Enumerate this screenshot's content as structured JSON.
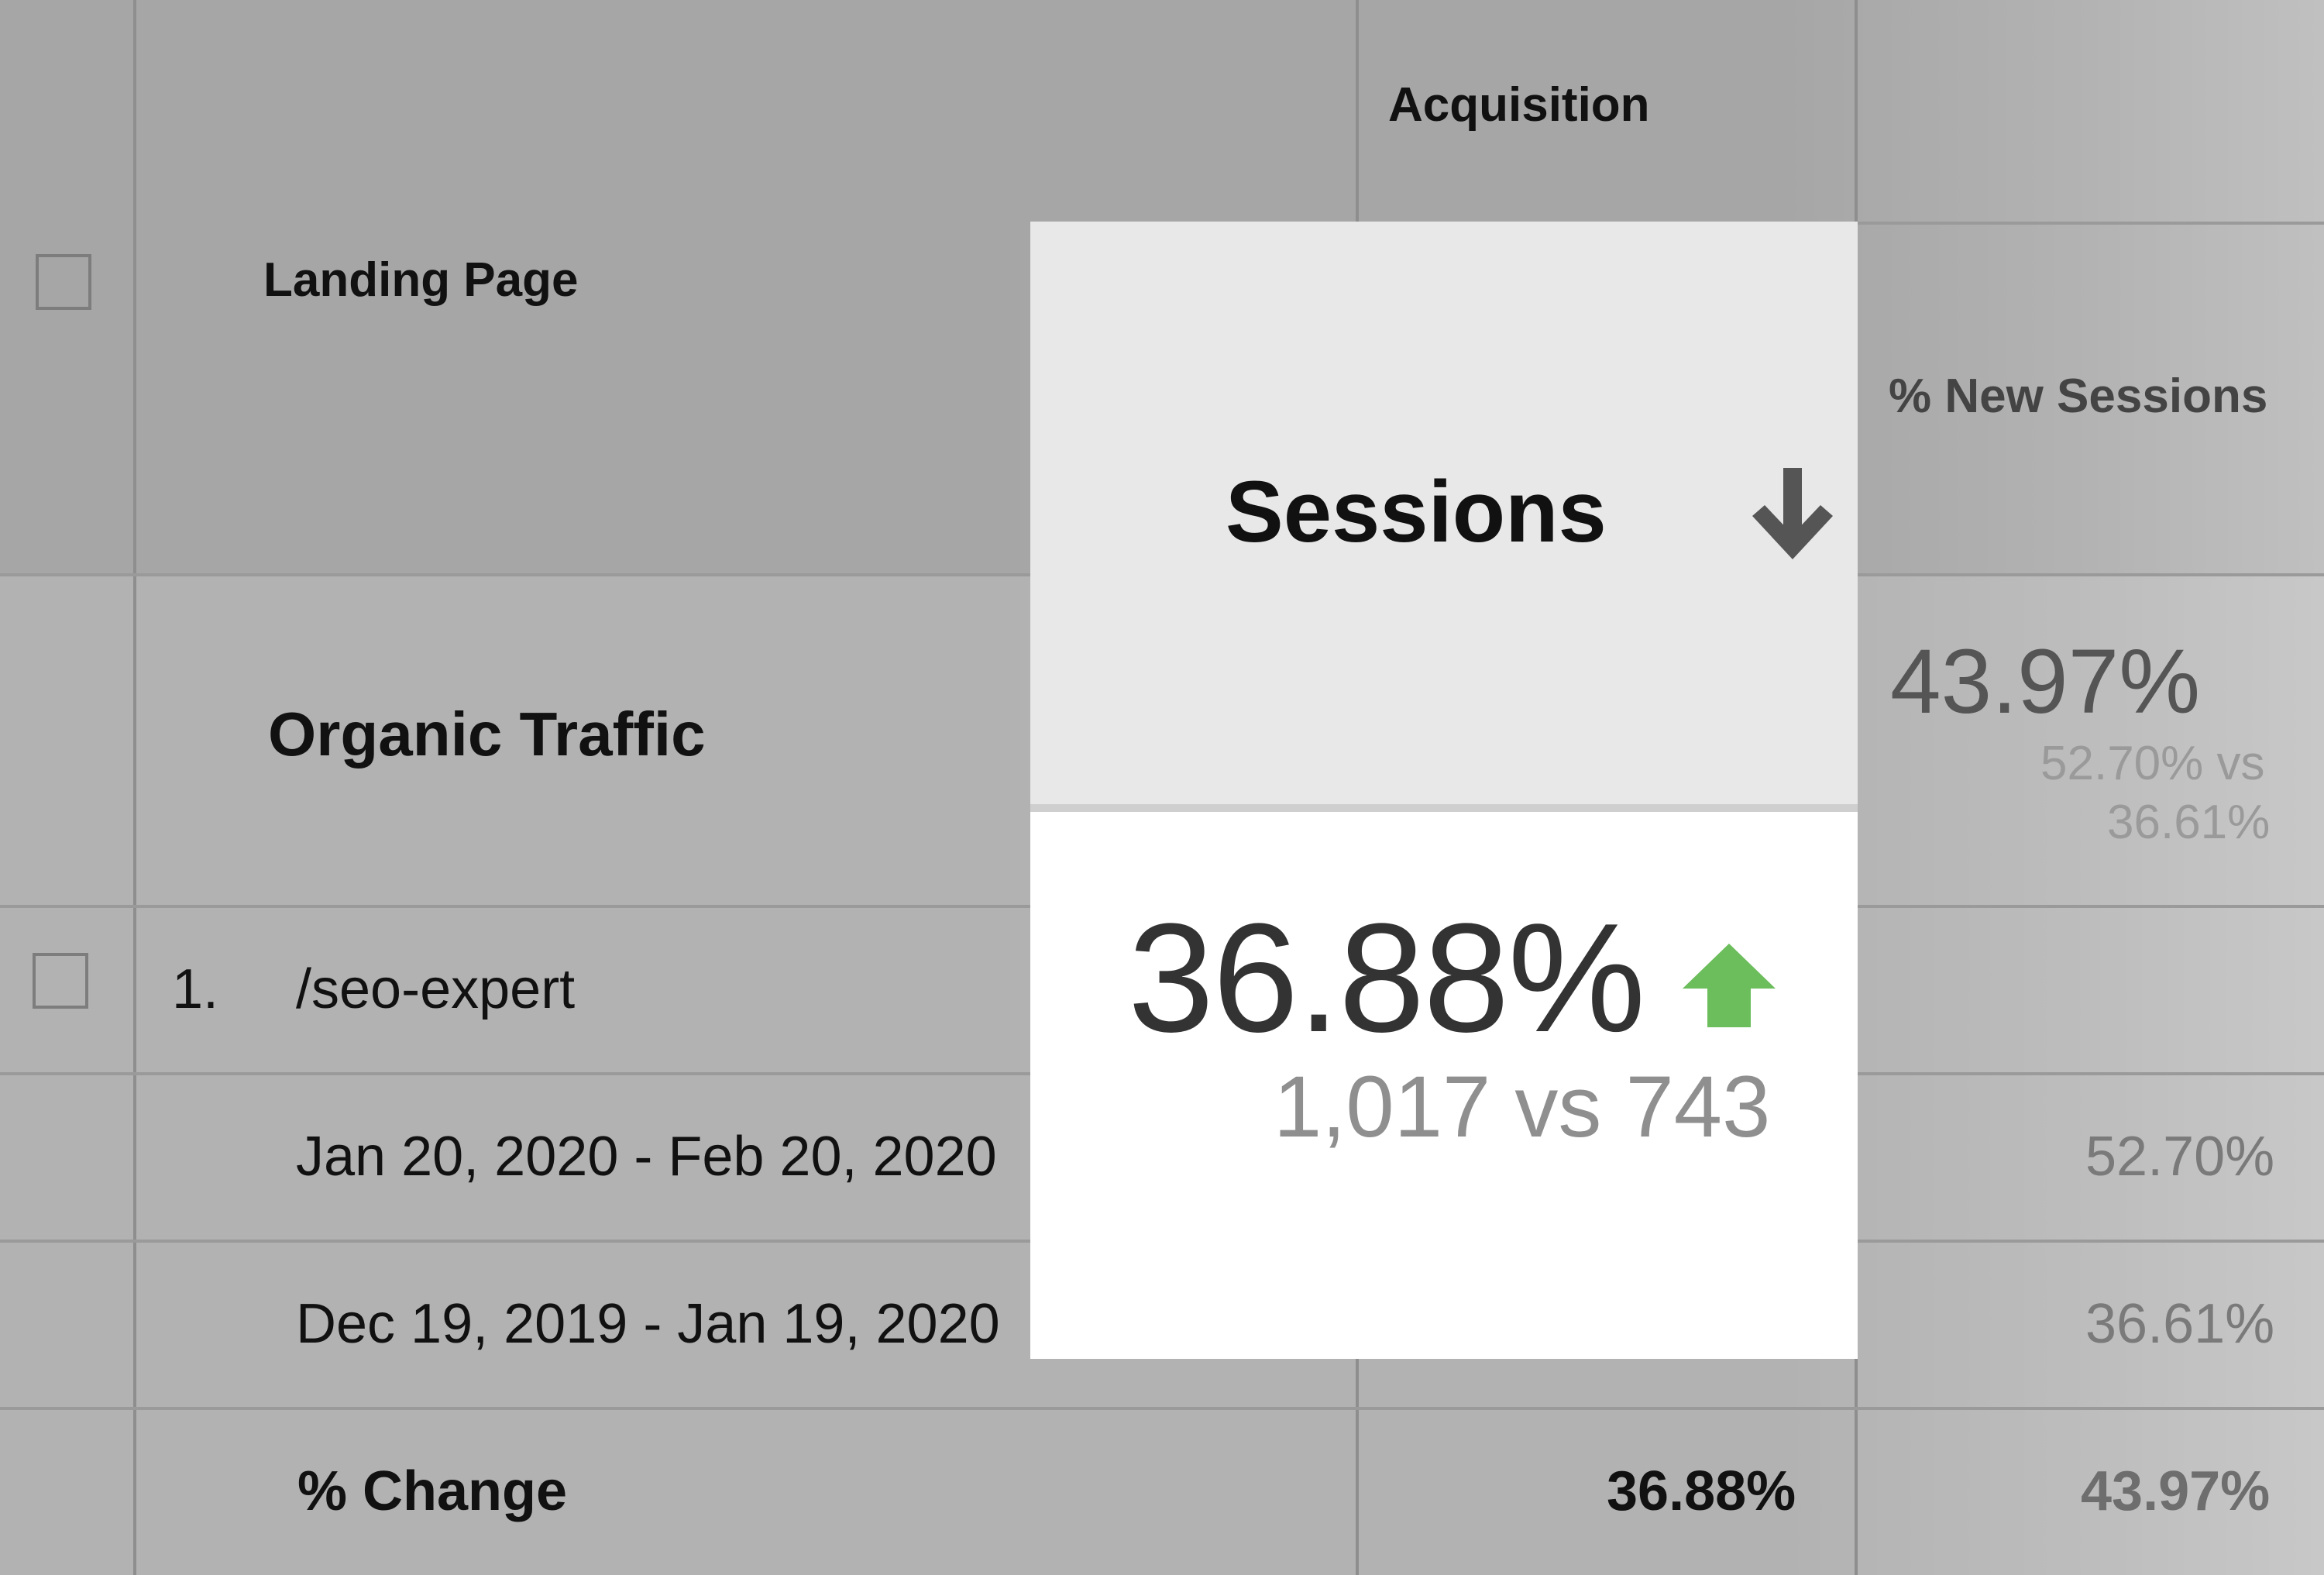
{
  "header": {
    "group_label": "Acquisition",
    "landing_page_label": "Landing Page",
    "new_sessions_label": "% New Sessions"
  },
  "segment": {
    "name": "Organic Traffic",
    "new_sessions_value": "43.97%",
    "new_sessions_compare_a": "52.70% vs",
    "new_sessions_compare_b": "36.61%"
  },
  "rows": [
    {
      "index": "1.",
      "page": "/seo-expert",
      "periods": [
        {
          "label": "Jan 20, 2020 - Feb 20, 2020",
          "new_sessions": "52.70%"
        },
        {
          "label": "Dec 19, 2019 - Jan 19, 2020",
          "new_sessions": "36.61%"
        }
      ],
      "change_label": "% Change",
      "change_sessions": "36.88%",
      "change_new_sessions": "43.97%"
    }
  ],
  "tooltip": {
    "column_label": "Sessions",
    "sort_icon": "arrow-down-icon",
    "value": "36.88%",
    "trend_icon": "arrow-up-icon",
    "trend_color": "#6cbd5c",
    "comparison": "1,017 vs 743"
  }
}
